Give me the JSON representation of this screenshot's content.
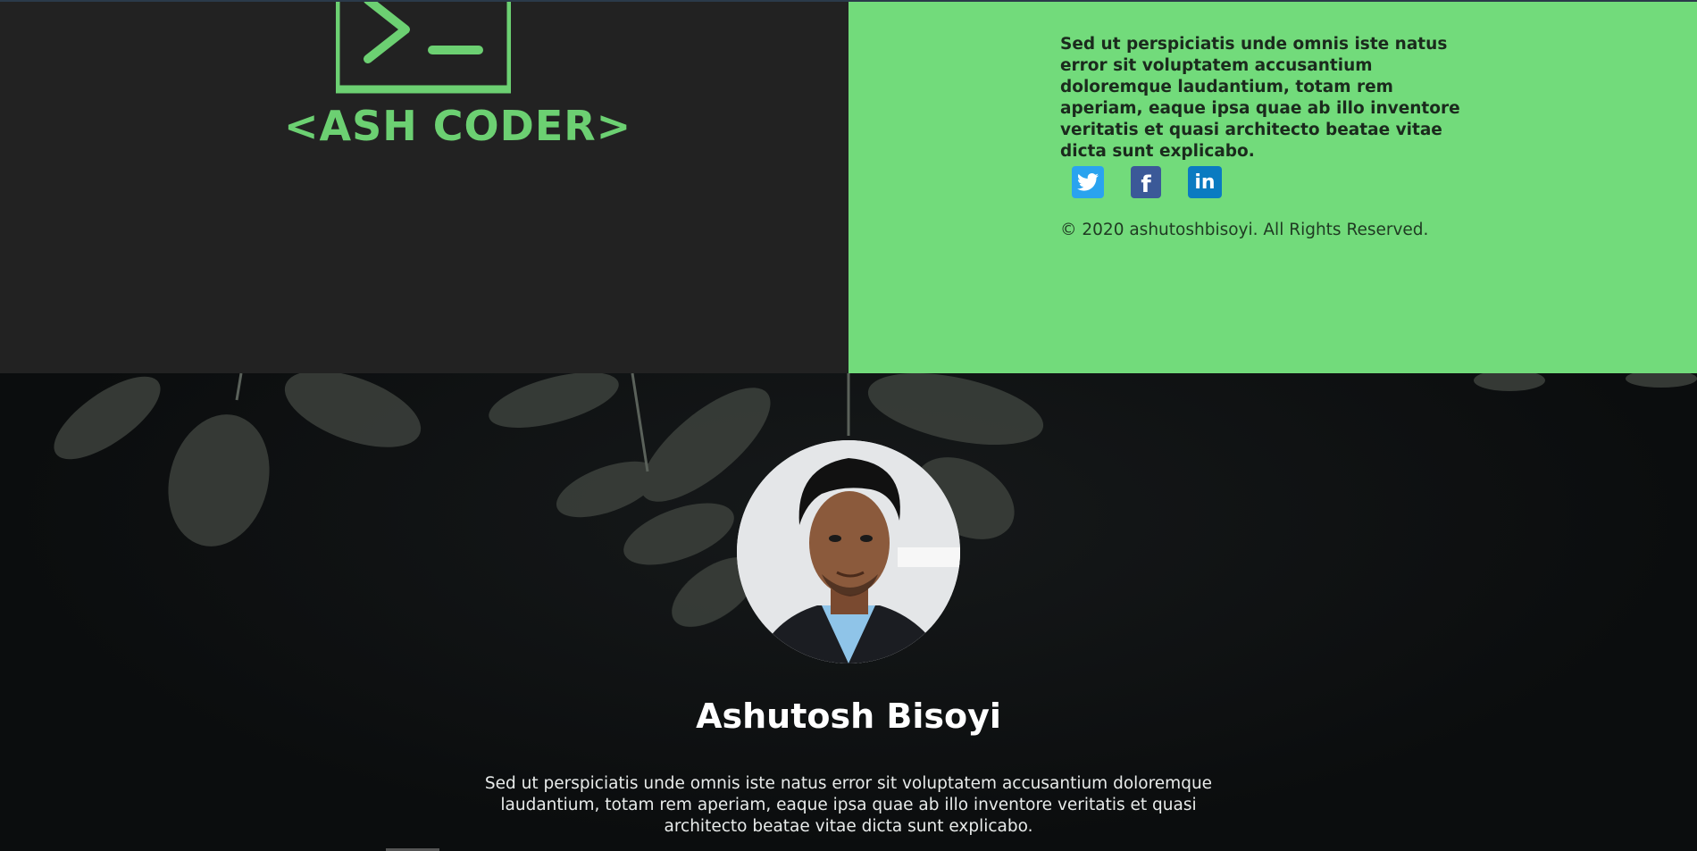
{
  "footer": {
    "logo_text": "<ASH CODER>",
    "description": "Sed ut perspiciatis unde omnis iste natus error sit voluptatem accusantium doloremque laudantium, totam rem aperiam, eaque ipsa quae ab illo inventore veritatis et quasi architecto beatae vitae dicta sunt explicabo.",
    "social": [
      {
        "icon": "twitter-icon",
        "glyph": "🐦"
      },
      {
        "icon": "facebook-icon",
        "glyph": "f"
      },
      {
        "icon": "linkedin-icon",
        "glyph": "in"
      }
    ],
    "copyright": "© 2020 ashutoshbisoyi. All Rights Reserved."
  },
  "hero": {
    "name": "Ashutosh Bisoyi",
    "description": "Sed ut perspiciatis unde omnis iste natus error sit voluptatem accusantium doloremque laudantium, totam rem aperiam, eaque ipsa quae ab illo inventore veritatis et quasi architecto beatae vitae dicta sunt explicabo."
  },
  "colors": {
    "accent_green": "#72db7b",
    "logo_green": "#6cd072",
    "dark_panel": "#222222",
    "hero_bg": "#0b0d0e"
  }
}
